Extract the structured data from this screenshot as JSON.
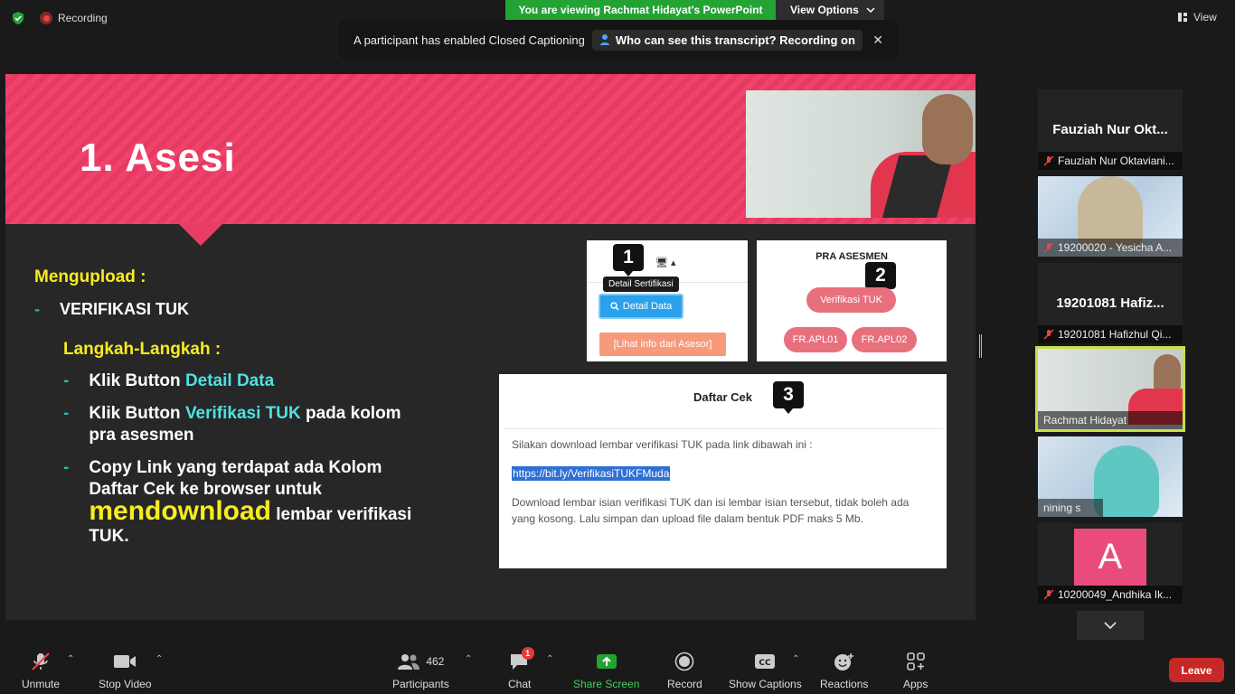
{
  "topbar": {
    "recording_label": "Recording",
    "viewing_banner": "You are viewing Rachmat Hidayat's PowerPoint",
    "view_options": "View Options",
    "view_label": "View",
    "cc_notice": "A participant has enabled Closed Captioning",
    "cc_link": "Who can see this transcript? Recording on"
  },
  "slide": {
    "title": "1. Asesi",
    "upload_heading": "Mengupload :",
    "dash": "-",
    "verif_tuk": "VERIFIKASI TUK",
    "langkah_heading": "Langkah-Langkah :",
    "steps": [
      {
        "a": "Klik Button ",
        "hl": "Detail Data",
        "b": ""
      },
      {
        "a": "Klik Button ",
        "hl": "Verifikasi TUK",
        "b": " pada kolom pra asesmen"
      },
      {
        "a": "Copy Link yang terdapat ada Kolom Daftar Cek ke browser untuk ",
        "big": "mendownload",
        "b": " lembar verifikasi TUK."
      }
    ],
    "box1": {
      "badge": "1",
      "tooltip": "Detail Sertifikasi",
      "detail_btn": "Detail Data",
      "lihat_btn": "[Lihat info dari Asesor]"
    },
    "box2": {
      "badge": "2",
      "title": "PRA ASESMEN",
      "verif_btn": "Verifikasi TUK",
      "apl01": "FR.APL01",
      "apl02": "FR.APL02"
    },
    "box3": {
      "badge": "3",
      "title": "Daftar Cek",
      "intro": "Silakan download lembar verifikasi TUK pada link dibawah ini :",
      "link": "https://bit.ly/VerifikasiTUKFMuda",
      "note": "Download lembar isian verifikasi TUK dan isi lembar isian tersebut, tidak boleh ada yang kosong. Lalu simpan dan upload file dalam bentuk PDF maks 5 Mb."
    }
  },
  "participants": [
    {
      "big_name": "Fauziah Nur Okt...",
      "label": "Fauziah Nur Oktaviani..."
    },
    {
      "label": "19200020 - Yesicha A..."
    },
    {
      "big_name": "19201081 Hafiz...",
      "label": "19201081 Hafizhul Qi..."
    },
    {
      "label": "Rachmat Hidayat"
    },
    {
      "label": "nining s"
    },
    {
      "avatar_letter": "A",
      "label": "10200049_Andhika Ik..."
    }
  ],
  "toolbar": {
    "unmute": "Unmute",
    "stop_video": "Stop Video",
    "participants": "Participants",
    "participants_count": "462",
    "chat": "Chat",
    "chat_badge": "1",
    "share_screen": "Share Screen",
    "record": "Record",
    "show_captions": "Show Captions",
    "reactions": "Reactions",
    "apps": "Apps",
    "leave": "Leave"
  },
  "colors": {
    "accent_pink": "#f0436c",
    "highlight_yellow": "#f8ec1e",
    "highlight_cyan": "#4de2e4",
    "banner_green": "#23a334",
    "leave_red": "#c62828"
  }
}
